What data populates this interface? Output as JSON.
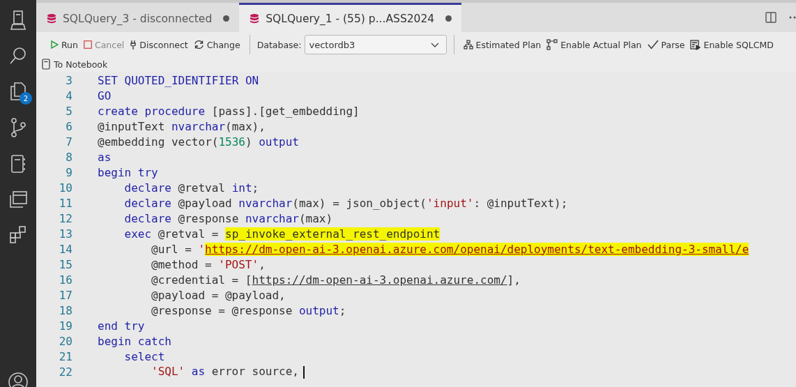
{
  "activity_bar": {
    "badge": "2"
  },
  "tabs": [
    {
      "label": "SQLQuery_3 - disconnected",
      "selected": false,
      "unsaved": true
    },
    {
      "label": "SQLQuery_1 - (55) p...ASS2024",
      "selected": true,
      "unsaved": true
    }
  ],
  "toolbar": {
    "actions": [
      {
        "label": "Run",
        "disabled": false
      },
      {
        "label": "Cancel",
        "disabled": true
      },
      {
        "label": "Disconnect",
        "disabled": false
      },
      {
        "label": "Change",
        "disabled": false
      }
    ],
    "database": {
      "label": "Database:",
      "value": "vectordb3"
    },
    "plan_actions": [
      {
        "label": "Estimated Plan",
        "disabled": false
      },
      {
        "label": "Enable Actual Plan",
        "disabled": false
      },
      {
        "label": "Parse",
        "disabled": false
      },
      {
        "label": "Enable SQLCMD",
        "disabled": false
      }
    ],
    "notebook": {
      "label": "To Notebook"
    }
  },
  "editor": {
    "lines": [
      {
        "number": "3",
        "has_cursor": false,
        "tokens": [
          {
            "text": "SET QUOTED_IDENTIFIER ON",
            "kind": "keyword",
            "highlighted": false
          }
        ]
      },
      {
        "number": "4",
        "has_cursor": false,
        "tokens": [
          {
            "text": "GO",
            "kind": "keyword",
            "highlighted": false
          }
        ]
      },
      {
        "number": "5",
        "has_cursor": false,
        "tokens": [
          {
            "text": "create procedure ",
            "kind": "keyword",
            "highlighted": false
          },
          {
            "text": "[pass].[get_embedding]",
            "kind": "text",
            "highlighted": false
          }
        ]
      },
      {
        "number": "6",
        "has_cursor": false,
        "tokens": [
          {
            "text": "@inputText ",
            "kind": "text",
            "highlighted": false
          },
          {
            "text": "nvarchar",
            "kind": "keyword",
            "highlighted": false
          },
          {
            "text": "(max),",
            "kind": "text",
            "highlighted": false
          }
        ]
      },
      {
        "number": "7",
        "has_cursor": false,
        "tokens": [
          {
            "text": "@embedding vector(",
            "kind": "text",
            "highlighted": false
          },
          {
            "text": "1536",
            "kind": "number",
            "highlighted": false
          },
          {
            "text": ") ",
            "kind": "text",
            "highlighted": false
          },
          {
            "text": "output",
            "kind": "keyword",
            "highlighted": false
          }
        ]
      },
      {
        "number": "8",
        "has_cursor": false,
        "tokens": [
          {
            "text": "as",
            "kind": "keyword",
            "highlighted": false
          }
        ]
      },
      {
        "number": "9",
        "has_cursor": false,
        "tokens": [
          {
            "text": "begin try",
            "kind": "keyword",
            "highlighted": false
          }
        ],
        "children": [
          {
            "number": "10",
            "has_cursor": false,
            "tokens": [
              {
                "text": "declare",
                "kind": "keyword",
                "highlighted": false
              },
              {
                "text": " @retval ",
                "kind": "text",
                "highlighted": false
              },
              {
                "text": "int",
                "kind": "keyword",
                "highlighted": false
              },
              {
                "text": ";",
                "kind": "text",
                "highlighted": false
              }
            ]
          },
          {
            "number": "11",
            "has_cursor": false,
            "tokens": [
              {
                "text": "declare",
                "kind": "keyword",
                "highlighted": false
              },
              {
                "text": " @payload ",
                "kind": "text",
                "highlighted": false
              },
              {
                "text": "nvarchar",
                "kind": "keyword",
                "highlighted": false
              },
              {
                "text": "(max) = json_object(",
                "kind": "text",
                "highlighted": false
              },
              {
                "text": "'input'",
                "kind": "string",
                "highlighted": false
              },
              {
                "text": ": @inputText);",
                "kind": "text",
                "highlighted": false
              }
            ]
          },
          {
            "number": "12",
            "has_cursor": false,
            "tokens": [
              {
                "text": "declare",
                "kind": "keyword",
                "highlighted": false
              },
              {
                "text": " @response ",
                "kind": "text",
                "highlighted": false
              },
              {
                "text": "nvarchar",
                "kind": "keyword",
                "highlighted": false
              },
              {
                "text": "(max)",
                "kind": "text",
                "highlighted": false
              }
            ]
          },
          {
            "number": "13",
            "has_cursor": false,
            "tokens": [
              {
                "text": "exec",
                "kind": "keyword",
                "highlighted": false
              },
              {
                "text": " @retval = ",
                "kind": "text",
                "highlighted": false
              },
              {
                "text": "sp_invoke_external_rest_endpoint",
                "kind": "text",
                "highlighted": true
              }
            ],
            "children": [
              {
                "number": "14",
                "has_cursor": false,
                "tokens": [
                  {
                    "text": "@url = ",
                    "kind": "text",
                    "highlighted": false
                  },
                  {
                    "text": "'",
                    "kind": "string",
                    "highlighted": false
                  },
                  {
                    "text": "https://dm-open-ai-3.openai.azure.com/openai/deployments/text-embedding-3-small/e",
                    "kind": "string_link",
                    "highlighted": true
                  }
                ]
              },
              {
                "number": "15",
                "has_cursor": false,
                "tokens": [
                  {
                    "text": "@method = ",
                    "kind": "text",
                    "highlighted": false
                  },
                  {
                    "text": "'POST'",
                    "kind": "string",
                    "highlighted": false
                  },
                  {
                    "text": ",",
                    "kind": "text",
                    "highlighted": false
                  }
                ]
              },
              {
                "number": "16",
                "has_cursor": false,
                "tokens": [
                  {
                    "text": "@credential = [",
                    "kind": "text",
                    "highlighted": false
                  },
                  {
                    "text": "https://dm-open-ai-3.openai.azure.com/",
                    "kind": "link",
                    "highlighted": false
                  },
                  {
                    "text": "],",
                    "kind": "text",
                    "highlighted": false
                  }
                ]
              },
              {
                "number": "17",
                "has_cursor": false,
                "tokens": [
                  {
                    "text": "@payload = @payload,",
                    "kind": "text",
                    "highlighted": false
                  }
                ]
              },
              {
                "number": "18",
                "has_cursor": false,
                "tokens": [
                  {
                    "text": "@response = @response ",
                    "kind": "text",
                    "highlighted": false
                  },
                  {
                    "text": "output",
                    "kind": "keyword",
                    "highlighted": false
                  },
                  {
                    "text": ";",
                    "kind": "text",
                    "highlighted": false
                  }
                ]
              }
            ]
          }
        ]
      },
      {
        "number": "19",
        "has_cursor": false,
        "tokens": [
          {
            "text": "end try",
            "kind": "keyword",
            "highlighted": false
          }
        ]
      },
      {
        "number": "20",
        "has_cursor": false,
        "tokens": [
          {
            "text": "begin catch",
            "kind": "keyword",
            "highlighted": false
          }
        ],
        "children": [
          {
            "number": "21",
            "has_cursor": false,
            "tokens": [
              {
                "text": "select",
                "kind": "keyword",
                "highlighted": false
              }
            ],
            "children": [
              {
                "number": "22",
                "has_cursor": true,
                "tokens": [
                  {
                    "text": "'SQL'",
                    "kind": "string",
                    "highlighted": false
                  },
                  {
                    "text": " as",
                    "kind": "keyword",
                    "highlighted": false
                  },
                  {
                    "text": " error source,",
                    "kind": "text",
                    "highlighted": false
                  }
                ]
              }
            ]
          }
        ]
      }
    ]
  }
}
